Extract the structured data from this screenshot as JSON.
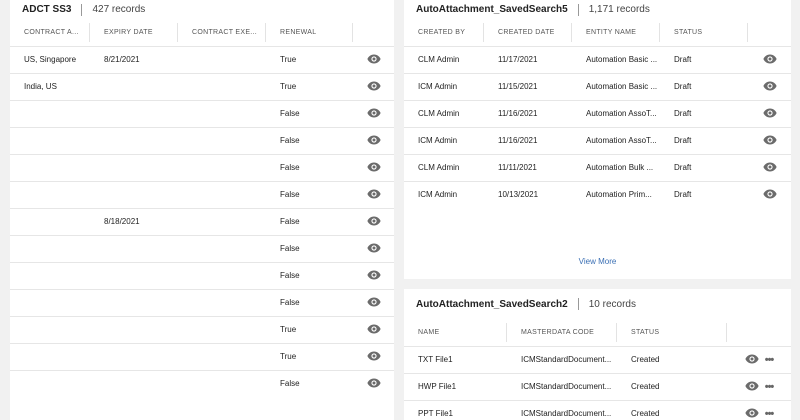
{
  "panel1": {
    "title": "ADCT SS3",
    "count": "427 records",
    "columns": [
      "CONTRACT A...",
      "EXPIRY DATE",
      "CONTRACT EXE...",
      "RENEWAL"
    ],
    "rows": [
      [
        "US, Singapore",
        "8/21/2021",
        "",
        "True"
      ],
      [
        "India, US",
        "",
        "",
        "True"
      ],
      [
        "",
        "",
        "",
        "False"
      ],
      [
        "",
        "",
        "",
        "False"
      ],
      [
        "",
        "",
        "",
        "False"
      ],
      [
        "",
        "",
        "",
        "False"
      ],
      [
        "",
        "8/18/2021",
        "",
        "False"
      ],
      [
        "",
        "",
        "",
        "False"
      ],
      [
        "",
        "",
        "",
        "False"
      ],
      [
        "",
        "",
        "",
        "False"
      ],
      [
        "",
        "",
        "",
        "True"
      ],
      [
        "",
        "",
        "",
        "True"
      ],
      [
        "",
        "",
        "",
        "False"
      ]
    ]
  },
  "panel2": {
    "title": "AutoAttachment_SavedSearch5",
    "count": "1,171 records",
    "columns": [
      "CREATED BY",
      "CREATED DATE",
      "ENTITY NAME",
      "STATUS"
    ],
    "rows": [
      [
        "CLM Admin",
        "11/17/2021",
        "Automation Basic ...",
        "Draft"
      ],
      [
        "ICM Admin",
        "11/15/2021",
        "Automation Basic ...",
        "Draft"
      ],
      [
        "CLM Admin",
        "11/16/2021",
        "Automation AssoT...",
        "Draft"
      ],
      [
        "ICM Admin",
        "11/16/2021",
        "Automation AssoT...",
        "Draft"
      ],
      [
        "CLM Admin",
        "11/11/2021",
        "Automation Bulk ...",
        "Draft"
      ],
      [
        "ICM Admin",
        "10/13/2021",
        "Automation Prim...",
        "Draft"
      ]
    ],
    "view_more": "View More"
  },
  "panel3": {
    "title": "AutoAttachment_SavedSearch2",
    "count": "10 records",
    "columns": [
      "NAME",
      "MASTERDATA CODE",
      "STATUS"
    ],
    "rows": [
      [
        "TXT File1",
        "ICMStandardDocument...",
        "Created"
      ],
      [
        "HWP File1",
        "ICMStandardDocument...",
        "Created"
      ],
      [
        "PPT File1",
        "ICMStandardDocument...",
        "Created"
      ]
    ]
  },
  "icons": {
    "view": "eye-icon",
    "more": "more-horizontal-icon"
  }
}
